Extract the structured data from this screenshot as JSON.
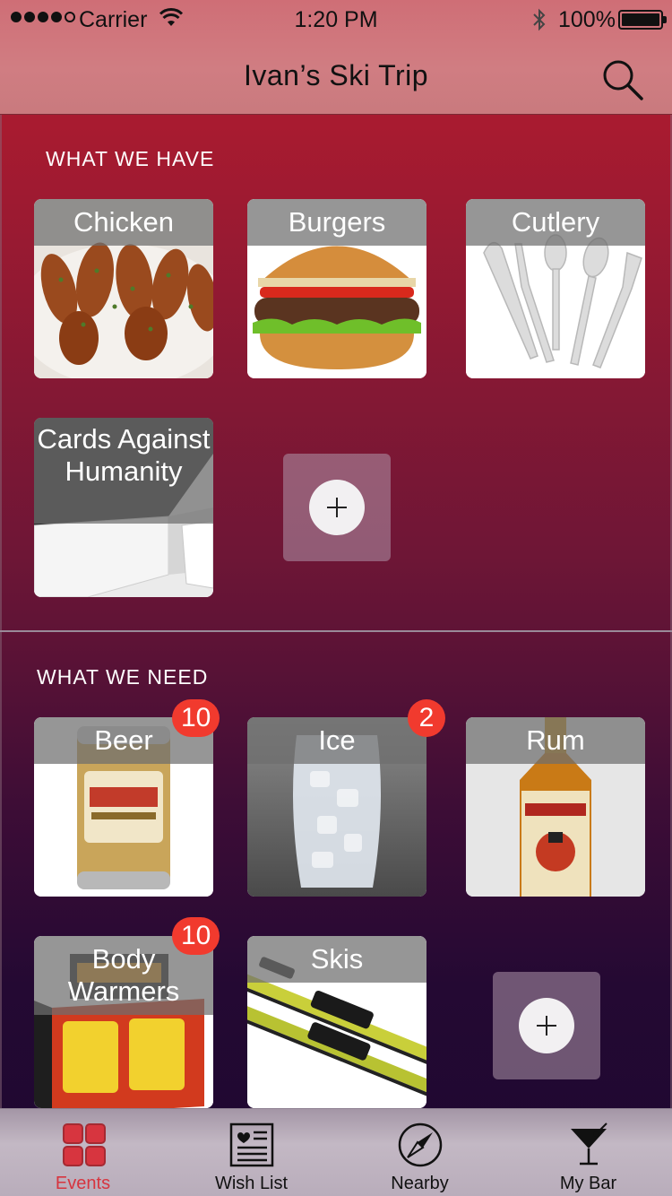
{
  "status_bar": {
    "carrier": "Carrier",
    "time": "1:20 PM",
    "battery": "100%"
  },
  "nav": {
    "title": "Ivan’s Ski Trip",
    "search_icon": "search-icon"
  },
  "have_section": {
    "title": "WHAT WE HAVE",
    "items": [
      {
        "label": "Chicken"
      },
      {
        "label": "Burgers"
      },
      {
        "label": "Cutlery"
      },
      {
        "label": "Cards Against Humanity"
      }
    ]
  },
  "need_section": {
    "title": "WHAT WE NEED",
    "items": [
      {
        "label": "Beer",
        "badge": "10"
      },
      {
        "label": "Ice",
        "badge": "2"
      },
      {
        "label": "Rum",
        "badge": ""
      },
      {
        "label": "Body Warmers",
        "badge": "10"
      },
      {
        "label": "Skis",
        "badge": ""
      }
    ]
  },
  "tab_bar": {
    "tabs": [
      {
        "label": "Events",
        "icon": "grid-icon",
        "active": true
      },
      {
        "label": "Wish List",
        "icon": "wishlist-icon",
        "active": false
      },
      {
        "label": "Nearby",
        "icon": "compass-icon",
        "active": false
      },
      {
        "label": "My Bar",
        "icon": "cocktail-icon",
        "active": false
      }
    ]
  },
  "colors": {
    "accent": "#d7353f",
    "badge": "#f13a2e",
    "header": "#cf6e76"
  }
}
